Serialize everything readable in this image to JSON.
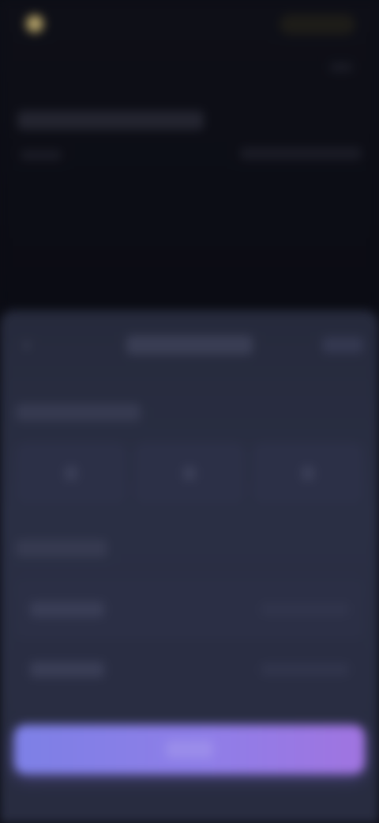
{
  "top": {
    "logo_text": "",
    "pill_text": "",
    "title": "",
    "subtitle": "",
    "subtitle_right": ""
  },
  "sheet": {
    "title": "",
    "action": "",
    "section1_title": "",
    "section2_title": "",
    "chips": [
      {
        "label": ""
      },
      {
        "label": ""
      },
      {
        "label": ""
      }
    ],
    "rows": [
      {
        "label": "",
        "value": ""
      },
      {
        "label": "",
        "value": ""
      }
    ],
    "cta_label": ""
  },
  "colors": {
    "background": "#0c0d15",
    "sheet": "#2a2f44",
    "cta_start": "#7d80e6",
    "cta_end": "#a074e0",
    "gold_accent": "#b9a96e"
  },
  "icons": {
    "back": "chevron-left-icon",
    "logo": "logo-icon"
  }
}
